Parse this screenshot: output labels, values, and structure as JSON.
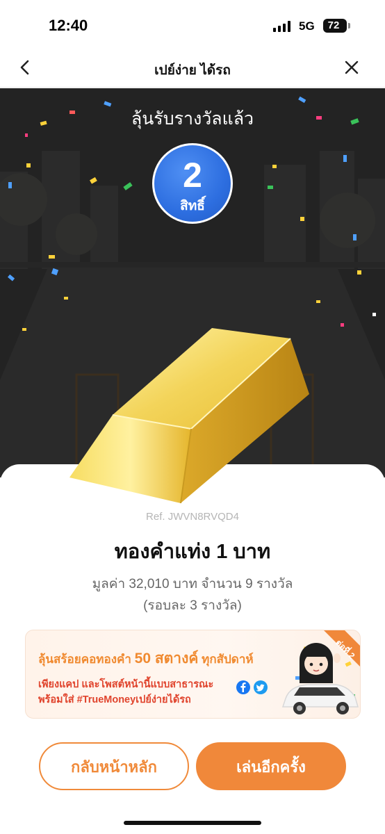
{
  "status_bar": {
    "time": "12:40",
    "network": "5G",
    "battery": "72"
  },
  "header": {
    "title": "เปย์ง่าย ได้รถ",
    "back_icon": "chevron-left-icon",
    "close_icon": "close-icon"
  },
  "result": {
    "heading": "ลุ้นรับรางวัลแล้ว",
    "rights_count": "2",
    "rights_unit": "สิทธิ์"
  },
  "prize": {
    "ref": "Ref. JWVN8RVQD4",
    "name": "ทองคำแท่ง 1 บาท",
    "value_line": "มูลค่า 32,010 บาท จำนวน 9 รางวัล",
    "rounds_line": "(รอบละ 3 รางวัล)"
  },
  "promo": {
    "title_prefix": "ลุ้นสร้อยคอทองคำ ",
    "title_highlight": "50 สตางค์",
    "title_suffix": " ทุกสัปดาห์",
    "line1": "เพียงแคป และโพสต์หน้านี้แบบสาธารณะ",
    "line2": "พร้อมใส่ #TrueMoneyเปย์ง่ายได้รถ",
    "corner_badge": "ต่อที่ 2",
    "icons": [
      "facebook-icon",
      "twitter-icon"
    ]
  },
  "buttons": {
    "home": "กลับหน้าหลัก",
    "play_again": "เล่นอีกครั้ง"
  },
  "colors": {
    "accent": "#f0883a",
    "badge_blue": "#2d6ee0",
    "promo_red": "#e0442d",
    "scene_bg": "#232323"
  }
}
